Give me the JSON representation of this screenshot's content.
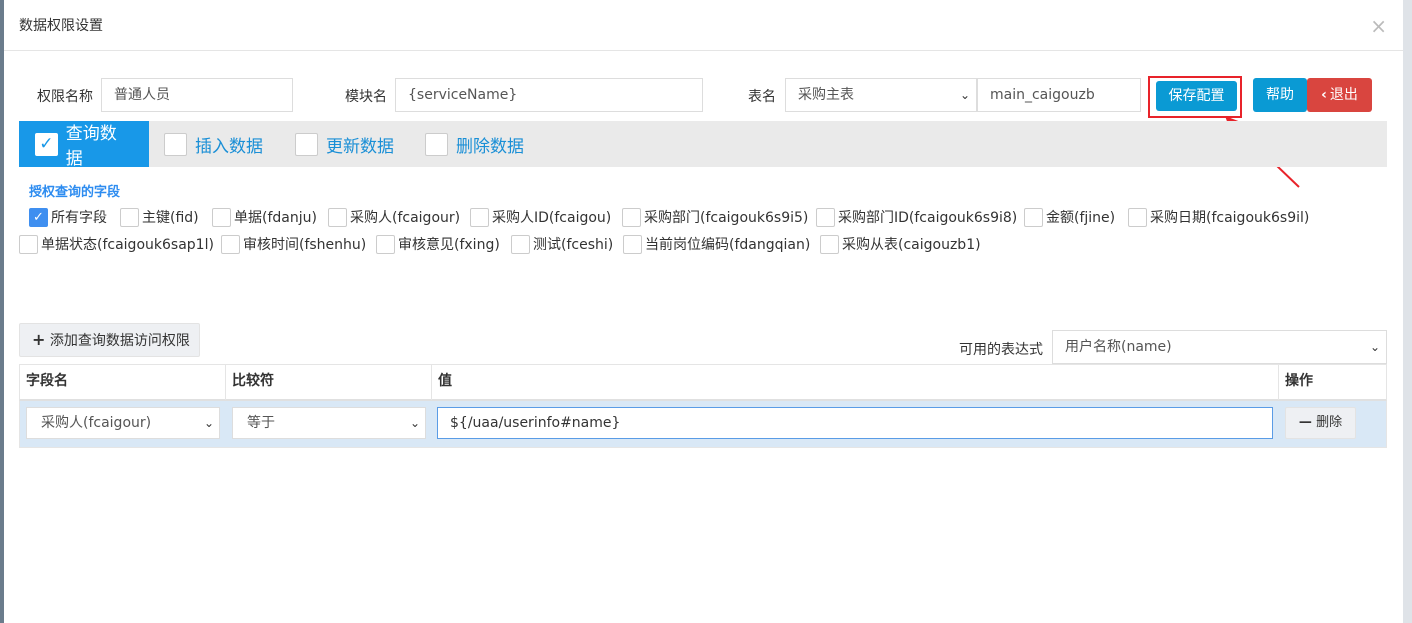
{
  "dialog": {
    "title": "数据权限设置",
    "close_glyph": "×"
  },
  "form": {
    "perm_name_label": "权限名称",
    "perm_name_value": "普通人员",
    "module_label": "模块名",
    "module_value": "{serviceName}",
    "table_label": "表名",
    "table_select_value": "采购主表",
    "table_code_value": "main_caigouzb"
  },
  "buttons": {
    "save": "保存配置",
    "help": "帮助",
    "exit": "退出",
    "exit_icon": "‹"
  },
  "tabs": [
    {
      "label": "查询数据",
      "checked": true
    },
    {
      "label": "插入数据",
      "checked": false
    },
    {
      "label": "更新数据",
      "checked": false
    },
    {
      "label": "删除数据",
      "checked": false
    }
  ],
  "fields_section": {
    "title": "授权查询的字段",
    "row1": [
      {
        "label": "所有字段",
        "checked": true
      },
      {
        "label": "主键(fid)",
        "checked": false
      },
      {
        "label": "单据(fdanju)",
        "checked": false
      },
      {
        "label": "采购人(fcaigour)",
        "checked": false
      },
      {
        "label": "采购人ID(fcaigou)",
        "checked": false
      },
      {
        "label": "采购部门(fcaigouk6s9i5)",
        "checked": false
      },
      {
        "label": "采购部门ID(fcaigouk6s9i8)",
        "checked": false
      },
      {
        "label": "金额(fjine)",
        "checked": false
      },
      {
        "label": "采购日期(fcaigouk6s9il)",
        "checked": false
      }
    ],
    "row2": [
      {
        "label": "单据状态(fcaigouk6sap1l)",
        "checked": false
      },
      {
        "label": "审核时间(fshenhu)",
        "checked": false
      },
      {
        "label": "审核意见(fxing)",
        "checked": false
      },
      {
        "label": "测试(fceshi)",
        "checked": false
      },
      {
        "label": "当前岗位编码(fdangqian)",
        "checked": false
      },
      {
        "label": "采购从表(caigouzb1)",
        "checked": false
      }
    ]
  },
  "access": {
    "add_label": "添加查询数据访问权限",
    "add_icon": "+",
    "expr_label": "可用的表达式",
    "expr_value": "用户名称(name)"
  },
  "table": {
    "headers": [
      "字段名",
      "比较符",
      "值",
      "操作"
    ],
    "rows": [
      {
        "field": "采购人(fcaigour)",
        "op": "等于",
        "value": "${/uaa/userinfo#name}",
        "action": "删除",
        "action_icon": "—"
      }
    ]
  },
  "colors": {
    "primary": "#1898e8",
    "danger": "#d9453f",
    "highlight": "#e8232a"
  }
}
